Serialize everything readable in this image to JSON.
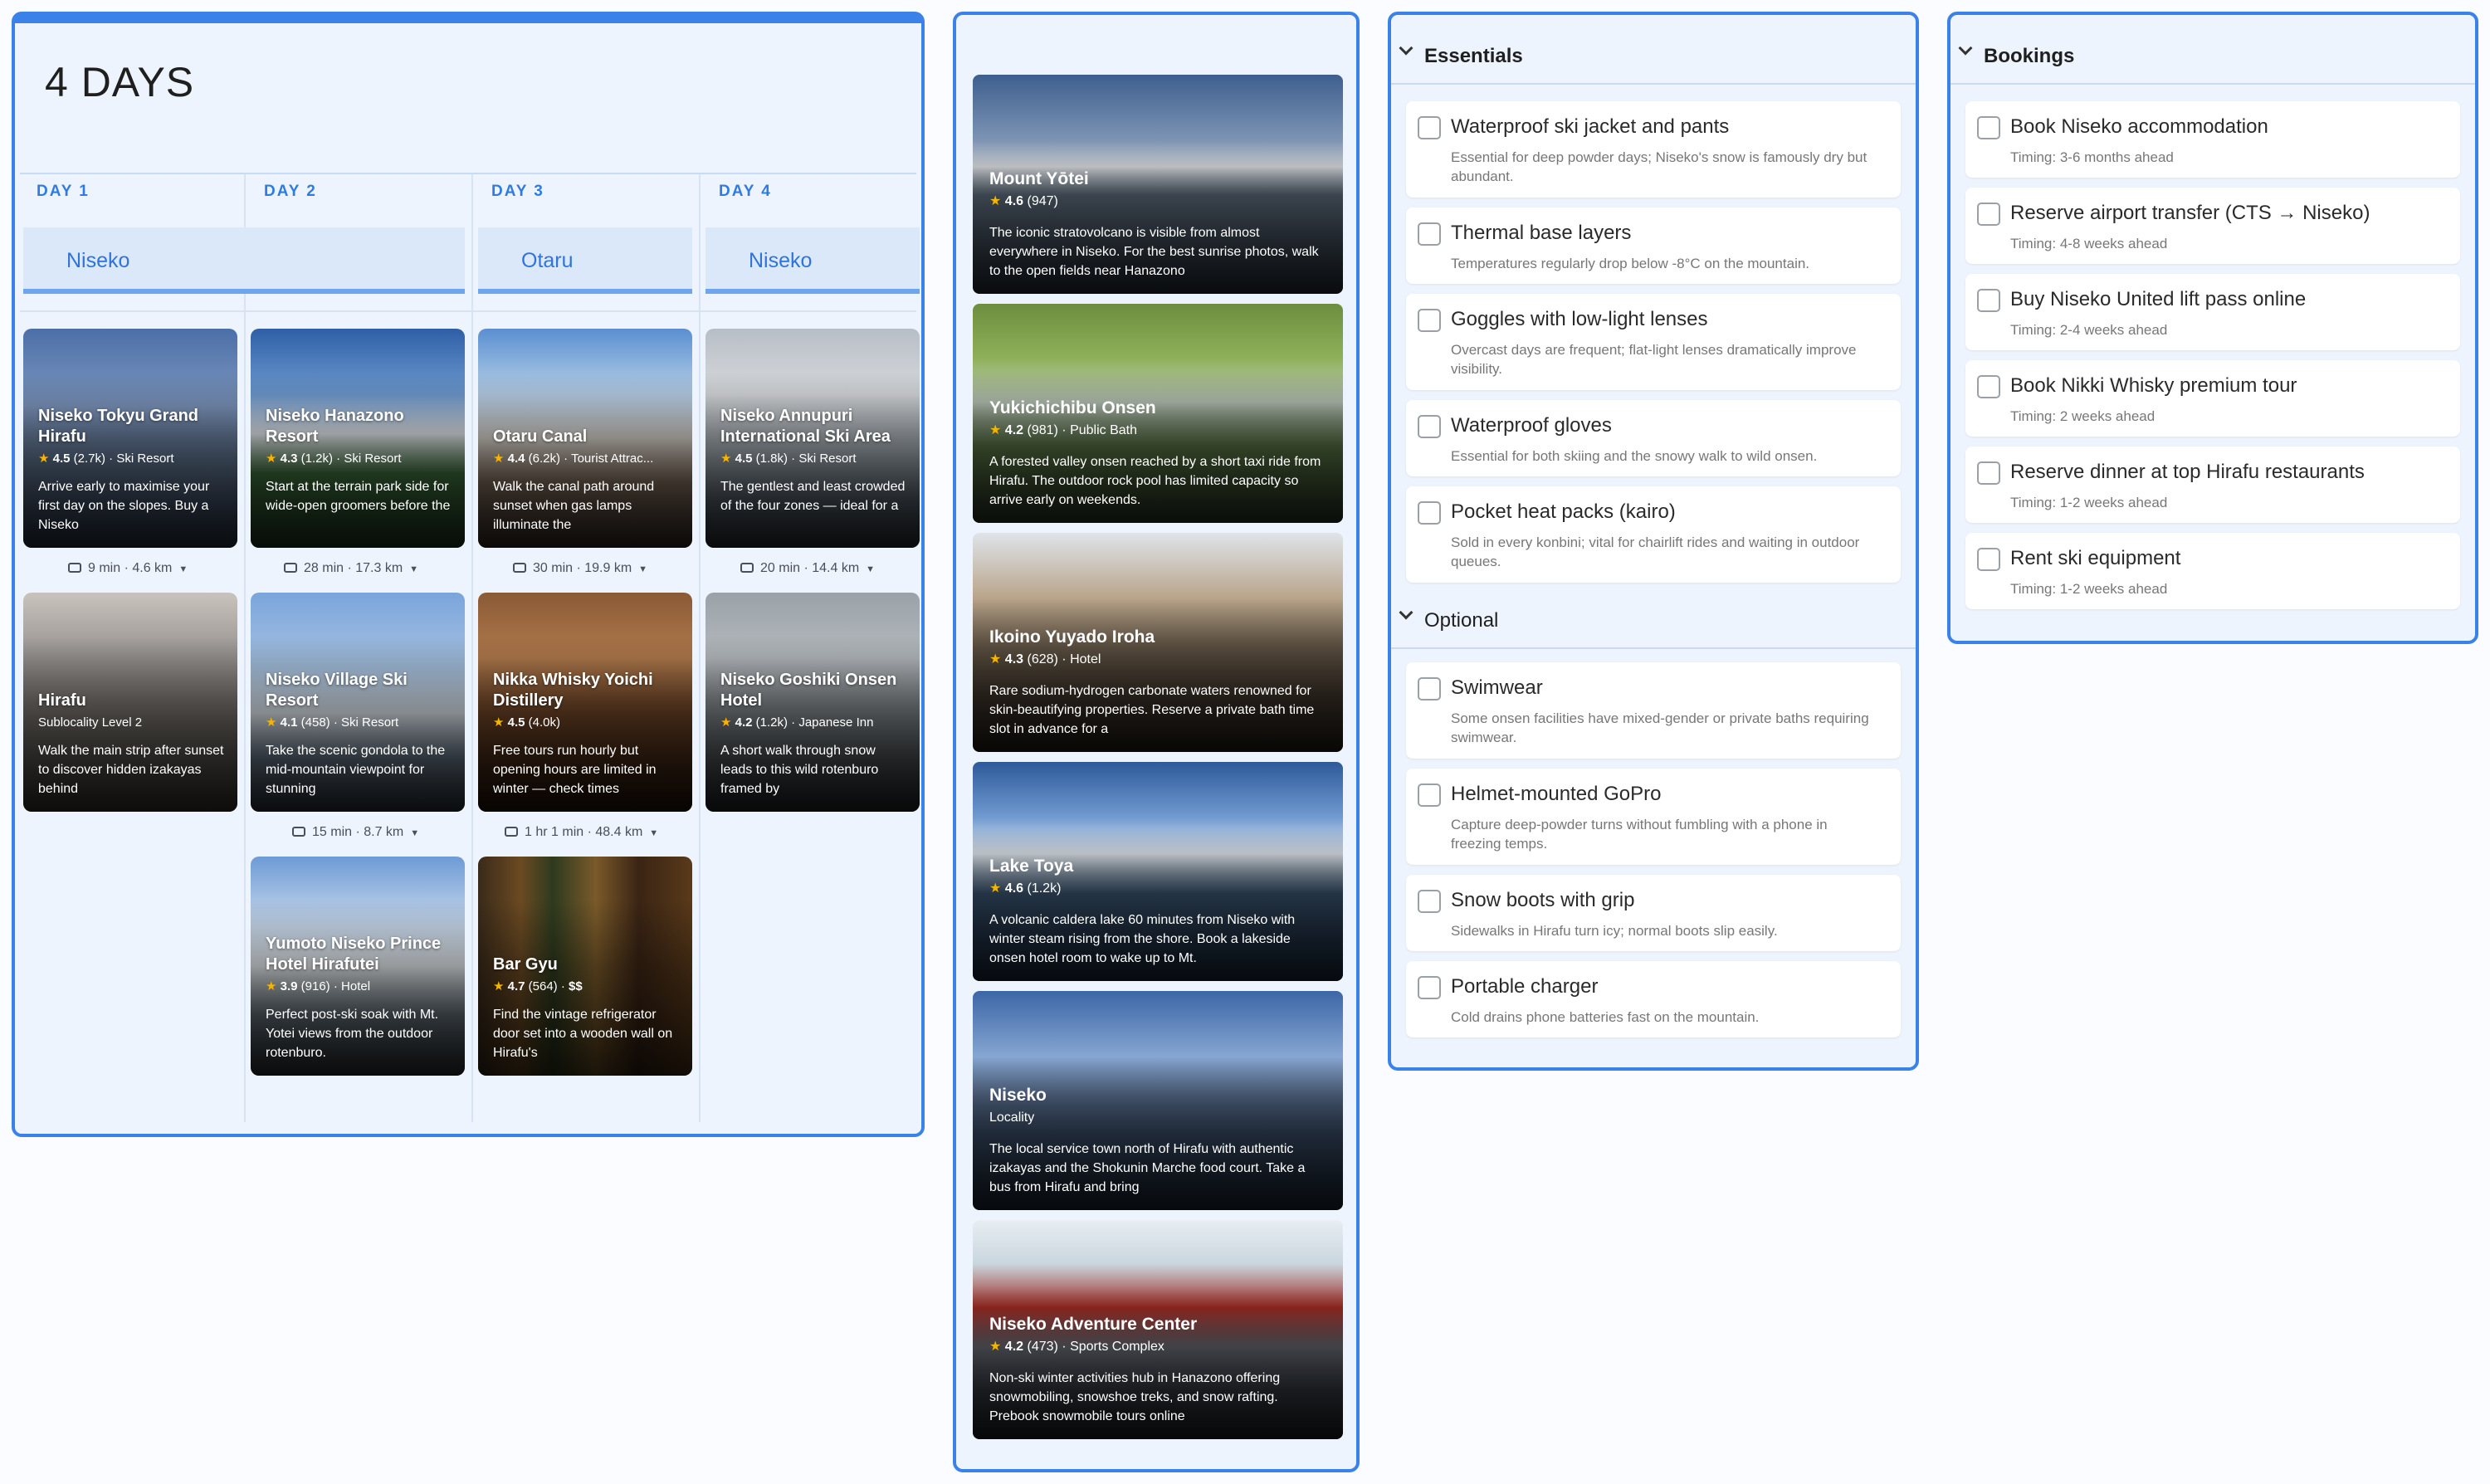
{
  "itinerary": {
    "title": "4 DAYS",
    "days": [
      {
        "label": "DAY 1",
        "location": "Niseko"
      },
      {
        "label": "DAY 2",
        "location": ""
      },
      {
        "label": "DAY 3",
        "location": "Otaru"
      },
      {
        "label": "DAY 4",
        "location": "Niseko"
      }
    ],
    "cards": [
      {
        "name": "Niseko Tokyu Grand Hirafu",
        "rating": "4.5",
        "count": "(2.7k)",
        "type": "Ski Resort",
        "desc": "Arrive early to maximise your first day on the slopes. Buy a Niseko"
      },
      {
        "name": "Hirafu",
        "subtitle": "Sublocality Level 2",
        "desc": "Walk the main strip after sunset to discover hidden izakayas behind"
      },
      {
        "name": "Niseko Hanazono Resort",
        "rating": "4.3",
        "count": "(1.2k)",
        "type": "Ski Resort",
        "desc": "Start at the terrain park side for wide-open groomers before the"
      },
      {
        "name": "Niseko Village Ski Resort",
        "rating": "4.1",
        "count": "(458)",
        "type": "Ski Resort",
        "desc": "Take the scenic gondola to the mid-mountain viewpoint for stunning"
      },
      {
        "name": "Yumoto Niseko Prince Hotel Hirafutei",
        "rating": "3.9",
        "count": "(916)",
        "type": "Hotel",
        "desc": "Perfect post-ski soak with Mt. Yotei views from the outdoor rotenburo."
      },
      {
        "name": "Otaru Canal",
        "rating": "4.4",
        "count": "(6.2k)",
        "type": "Tourist Attrac...",
        "desc": "Walk the canal path around sunset when gas lamps illuminate the"
      },
      {
        "name": "Nikka Whisky Yoichi Distillery",
        "rating": "4.5",
        "count": "(4.0k)",
        "type": "",
        "desc": "Free tours run hourly but opening hours are limited in winter — check times"
      },
      {
        "name": "Bar Gyu",
        "rating": "4.7",
        "count": "(564)",
        "type": "$$",
        "desc": "Find the vintage refrigerator door set into a wooden wall on Hirafu's"
      },
      {
        "name": "Niseko Annupuri International Ski Area",
        "rating": "4.5",
        "count": "(1.8k)",
        "type": "Ski Resort",
        "desc": "The gentlest and least crowded of the four zones — ideal for a"
      },
      {
        "name": "Niseko Goshiki Onsen Hotel",
        "rating": "4.2",
        "count": "(1.2k)",
        "type": "Japanese Inn",
        "desc": "A short walk through snow leads to this wild rotenburo framed by"
      }
    ],
    "travel": [
      "9 min · 4.6 km",
      "28 min · 17.3 km",
      "15 min · 8.7 km",
      "30 min · 19.9 km",
      "1 hr 1 min · 48.4 km",
      "20 min · 14.4 km"
    ]
  },
  "explore": [
    {
      "name": "Mount Yōtei",
      "rating": "4.6",
      "count": "(947)",
      "type": "",
      "desc": "The iconic stratovolcano is visible from almost everywhere in Niseko. For the best sunrise photos, walk to the open fields near Hanazono"
    },
    {
      "name": "Yukichichibu Onsen",
      "rating": "4.2",
      "count": "(981)",
      "type": "Public Bath",
      "desc": "A forested valley onsen reached by a short taxi ride from Hirafu. The outdoor rock pool has limited capacity so arrive early on weekends."
    },
    {
      "name": "Ikoino Yuyado Iroha",
      "rating": "4.3",
      "count": "(628)",
      "type": "Hotel",
      "desc": "Rare sodium-hydrogen carbonate waters renowned for skin-beautifying properties. Reserve a private bath time slot in advance for a"
    },
    {
      "name": "Lake Toya",
      "rating": "4.6",
      "count": "(1.2k)",
      "type": "",
      "desc": "A volcanic caldera lake 60 minutes from Niseko with winter steam rising from the shore. Book a lakeside onsen hotel room to wake up to Mt."
    },
    {
      "name": "Niseko",
      "subtitle": "Locality",
      "desc": "The local service town north of Hirafu with authentic izakayas and the Shokunin Marche food court. Take a bus from Hirafu and bring"
    },
    {
      "name": "Niseko Adventure Center",
      "rating": "4.2",
      "count": "(473)",
      "type": "Sports Complex",
      "desc": "Non-ski winter activities hub in Hanazono offering snowmobiling, snowshoe treks, and snow rafting. Prebook snowmobile tours online"
    }
  ],
  "essentials": {
    "title": "Essentials",
    "items": [
      {
        "title": "Waterproof ski jacket and pants",
        "note": "Essential for deep powder days; Niseko's snow is famously dry but abundant."
      },
      {
        "title": "Thermal base layers",
        "note": "Temperatures regularly drop below -8°C on the mountain."
      },
      {
        "title": "Goggles with low-light lenses",
        "note": "Overcast days are frequent; flat-light lenses dramatically improve visibility."
      },
      {
        "title": "Waterproof gloves",
        "note": "Essential for both skiing and the snowy walk to wild onsen."
      },
      {
        "title": "Pocket heat packs (kairo)",
        "note": "Sold in every konbini; vital for chairlift rides and waiting in outdoor queues."
      }
    ]
  },
  "optional": {
    "title": "Optional",
    "items": [
      {
        "title": "Swimwear",
        "note": "Some onsen facilities have mixed-gender or private baths requiring swimwear."
      },
      {
        "title": "Helmet-mounted GoPro",
        "note": "Capture deep-powder turns without fumbling with a phone in freezing temps."
      },
      {
        "title": "Snow boots with grip",
        "note": "Sidewalks in Hirafu turn icy; normal boots slip easily."
      },
      {
        "title": "Portable charger",
        "note": "Cold drains phone batteries fast on the mountain."
      }
    ]
  },
  "bookings": {
    "title": "Bookings",
    "items": [
      {
        "title": "Book Niseko accommodation",
        "note": "Timing: 3-6 months ahead"
      },
      {
        "title": "Reserve airport transfer (CTS → Niseko)",
        "note": "Timing: 4-8 weeks ahead"
      },
      {
        "title": "Buy Niseko United lift pass online",
        "note": "Timing: 2-4 weeks ahead"
      },
      {
        "title": "Book Nikki Whisky premium tour",
        "note": "Timing: 2 weeks ahead"
      },
      {
        "title": "Reserve dinner at top Hirafu restaurants",
        "note": "Timing: 1-2 weeks ahead"
      },
      {
        "title": "Rent ski equipment",
        "note": "Timing: 1-2 weeks ahead"
      }
    ]
  },
  "icons": {
    "star": "star-icon",
    "car": "car-icon",
    "chevron": "chevron-down-icon",
    "checkbox": "checkbox-icon",
    "pin": "map-pin-icon"
  },
  "colors": {
    "accent": "#3b82e8",
    "panel_bg": "#eef4fd",
    "star": "#f5b400",
    "location_text": "#2f74d8"
  }
}
